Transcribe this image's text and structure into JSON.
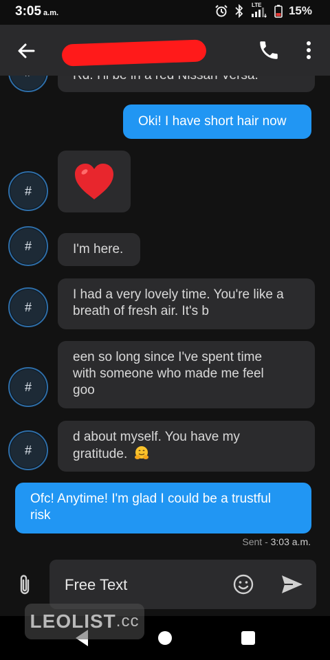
{
  "status": {
    "time": "3:05",
    "ampm": "a.m.",
    "battery": "15%",
    "network": "LTE"
  },
  "messages": [
    {
      "dir": "in",
      "text": "Rd. I'll be in a red Nissan Versa."
    },
    {
      "dir": "out",
      "text": "Oki! I have short hair now"
    },
    {
      "dir": "in",
      "emoji": "red-heart"
    },
    {
      "dir": "in",
      "text": "I'm here."
    },
    {
      "dir": "in",
      "lines": [
        "I had a very lovely time. You're like a",
        "breath of fresh air. It's b"
      ]
    },
    {
      "dir": "in",
      "lines": [
        "een so long since I've spent time",
        "with someone who made me feel",
        "goo"
      ]
    },
    {
      "dir": "in",
      "lines": [
        "d about myself. You have my",
        "gratitude."
      ],
      "emoji": "hugging-face"
    },
    {
      "dir": "out",
      "lines": [
        "Ofc! Anytime! I'm glad I could be a trustful",
        "risk"
      ]
    }
  ],
  "avatar_label": "#",
  "sent_info": {
    "label": "Sent - ",
    "time": "3:03 a.m."
  },
  "composer": {
    "placeholder": "Free Text"
  },
  "watermark": {
    "brand": "LEOLIST",
    "tld": ".cc"
  },
  "colors": {
    "incoming_bubble": "#2b2b2d",
    "outgoing_bubble": "#2196f3",
    "redaction": "#ff1a1a",
    "background": "#121212"
  }
}
